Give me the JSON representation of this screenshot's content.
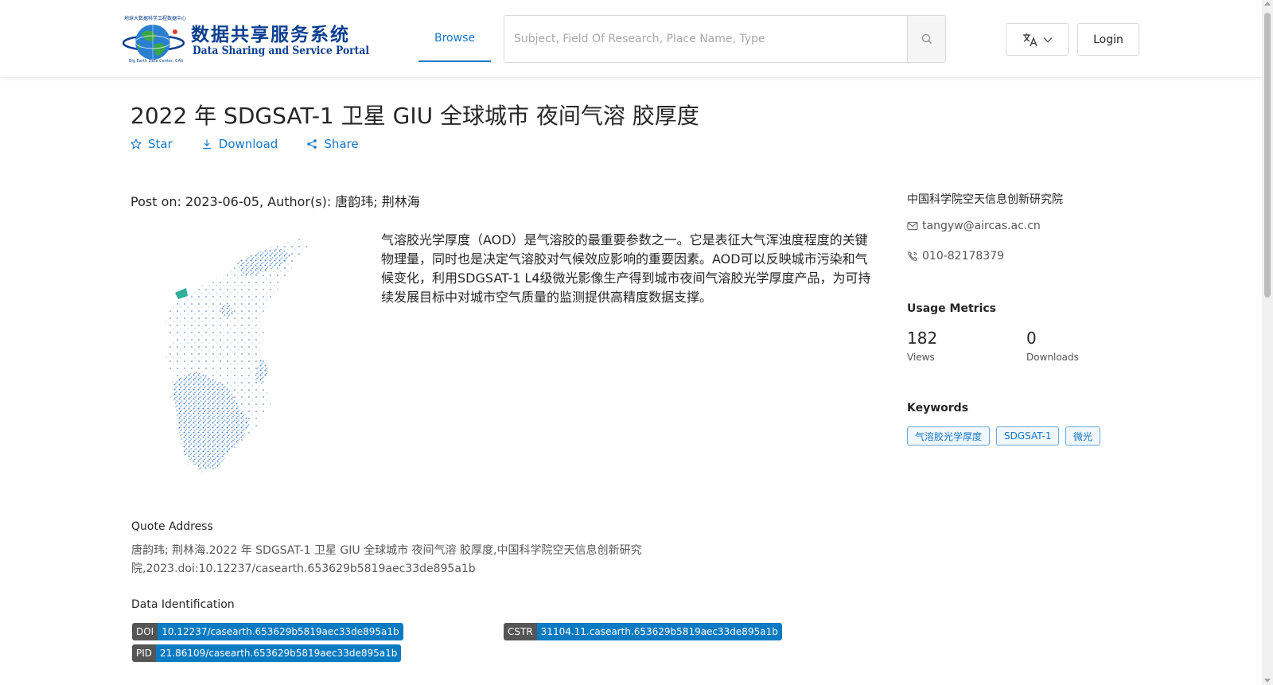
{
  "header": {
    "logo_cn": "数据共享服务系统",
    "logo_en": "Data Sharing and Service Portal",
    "logo_tag_top": "地球大数据科学工程数据中心",
    "logo_tag_bottom": "Big Earth Data Center, CAS",
    "nav_browse": "Browse",
    "search_placeholder": "Subject, Field Of Research, Place Name, Type",
    "login": "Login"
  },
  "dataset": {
    "title": "2022 年 SDGSAT-1 卫星 GIU 全球城市 夜间气溶 胶厚度",
    "actions": {
      "star": "Star",
      "download": "Download",
      "share": "Share"
    },
    "post_line": "Post on: 2023-06-05, Author(s): 唐韵玮; 荆林海",
    "description": "气溶胶光学厚度（AOD）是气溶胶的最重要参数之一。它是表征大气浑浊度程度的关键物理量，同时也是决定气溶胶对气候效应影响的重要因素。AOD可以反映城市污染和气候变化，利用SDGSAT-1 L4级微光影像生产得到城市夜间气溶胶光学厚度产品，为可持续发展目标中对城市空气质量的监测提供高精度数据支撑。",
    "quote_label": "Quote Address",
    "quote_text": "唐韵玮; 荆林海.2022 年 SDGSAT-1 卫星 GIU 全球城市 夜间气溶 胶厚度,中国科学院空天信息创新研究院,2023.doi:10.12237/casearth.653629b5819aec33de895a1b",
    "ident_label": "Data Identification",
    "doi_key": "DOI",
    "doi_value": "10.12237/casearth.653629b5819aec33de895a1b",
    "cstr_key": "CSTR",
    "cstr_value": "31104.11.casearth.653629b5819aec33de895a1b",
    "pid_key": "PID",
    "pid_value": "21.86109/casearth.653629b5819aec33de895a1b"
  },
  "sidebar": {
    "org": "中国科学院空天信息创新研究院",
    "email": "tangyw@aircas.ac.cn",
    "phone": "010-82178379",
    "metrics_title": "Usage Metrics",
    "views_value": "182",
    "views_label": "Views",
    "downloads_value": "0",
    "downloads_label": "Downloads",
    "keywords_title": "Keywords",
    "keywords": [
      "气溶胶光学厚度",
      "SDGSAT-1",
      "微光"
    ]
  },
  "colors": {
    "accent": "#1677c8",
    "tag_key_bg": "#555555",
    "tag_value_bg": "#0a7bc2"
  },
  "icons": {
    "star": "star-icon",
    "download": "download-icon",
    "share": "share-icon",
    "search": "search-icon",
    "language": "translate-icon",
    "email": "mail-icon",
    "phone": "phone-icon"
  }
}
